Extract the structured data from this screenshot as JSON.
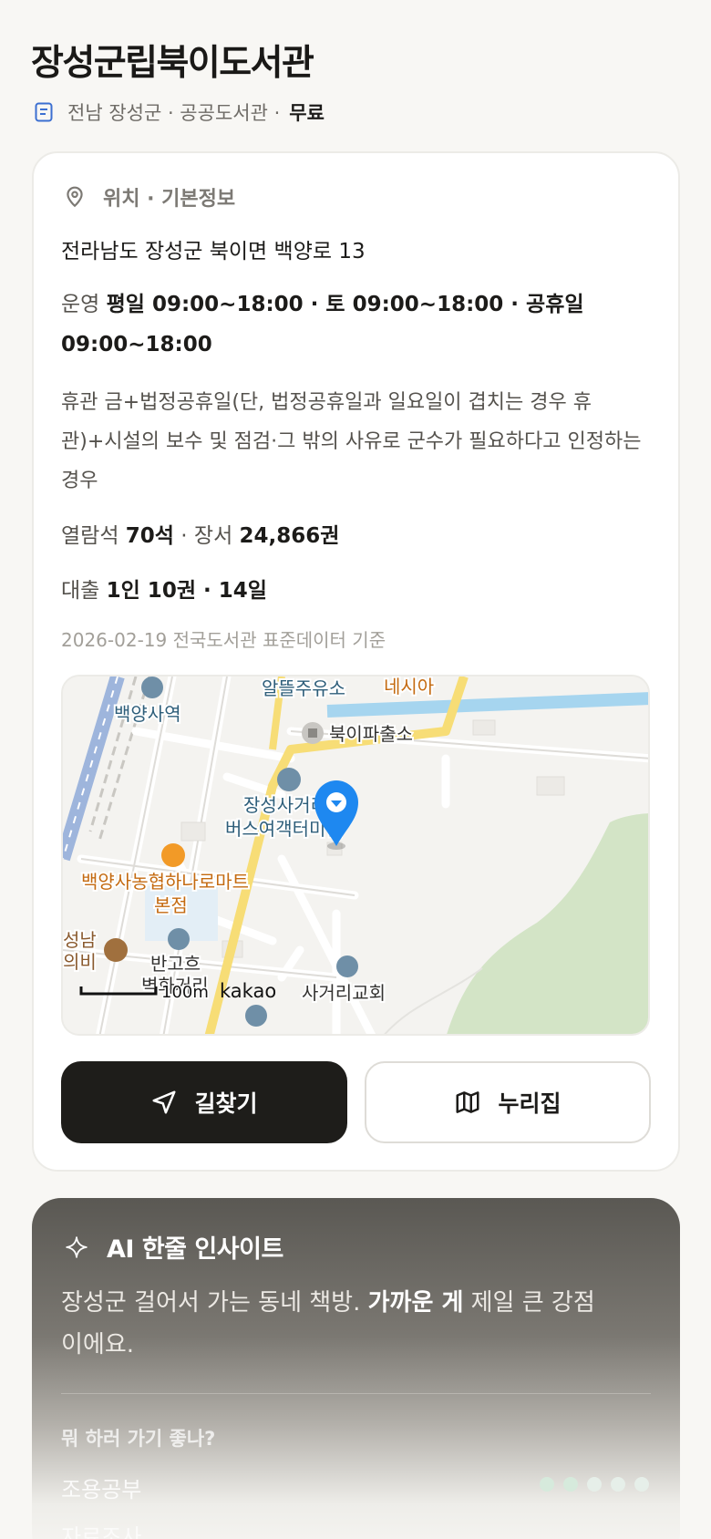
{
  "header": {
    "title": "장성군립북이도서관",
    "meta": "전남 장성군 · 공공도서관 ·",
    "price": "무료"
  },
  "info": {
    "section_label": "위치 · 기본정보",
    "address": "전라남도 장성군 북이면 백양로 13",
    "hours_key": "운영",
    "hours_value": "평일 09:00~18:00 · 토 09:00~18:00 · 공휴일 09:00~18:00",
    "closed_text": "휴관 금+법정공휴일(단, 법정공휴일과 일요일이 겹치는 경우 휴관)+시설의 보수 및 점검·그 밖의 사유로 군수가 필요하다고 인정하는 경우",
    "seats_key": "열람석",
    "seats_value": "70석",
    "books_key": "· 장서",
    "books_value": "24,866권",
    "loan_key": "대출",
    "loan_value": "1인 10권 · 14일",
    "as_of": "2026-02-19 전국도서관 표준데이터 기준"
  },
  "map": {
    "labels": {
      "station": "백양사역",
      "gas": "알뜰주유소",
      "nesia": "네시아",
      "police": "북이파출소",
      "terminal_1": "장성사거리",
      "terminal_2": "버스여객터미널",
      "mart_1": "백양사농협하나로마트",
      "mart_2": "본점",
      "seongnam_1": "성남",
      "seongnam_2": "의비",
      "bango_1": "반고흐",
      "bango_2": "벽화거리",
      "church": "사거리교회",
      "scale": "100m",
      "brand": "kakao"
    }
  },
  "actions": {
    "directions": "길찾기",
    "nurijip": "누리집"
  },
  "ai": {
    "title": "AI 한줄 인사이트",
    "text_before": "장성군 걸어서 가는 동네 책방.",
    "text_bold": "가까운 게",
    "text_after": "제일 큰 강점이에요.",
    "question": "뭐 하러 가기 좋나?",
    "option_1": "조용공부",
    "option_2": "자료조사"
  },
  "colors": {
    "accent_dark": "#1e1d1a",
    "map_pin": "#1e88f0",
    "road_yellow": "#f5d86a"
  }
}
